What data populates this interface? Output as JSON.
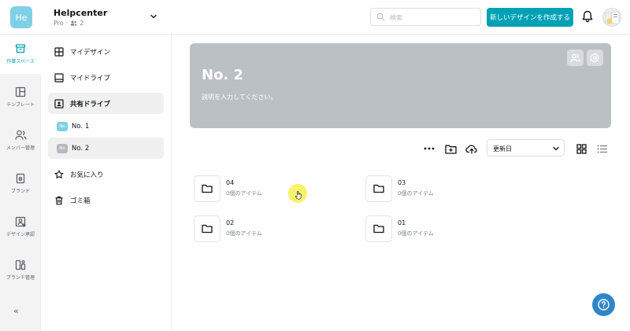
{
  "header": {
    "team_avatar": "He",
    "team_name": "Helpcenter",
    "team_plan": "Pro",
    "member_count": "2",
    "search_placeholder": "検索",
    "create_button": "新しいデザインを作成する"
  },
  "rail": {
    "items": [
      {
        "label": "作業スペース",
        "icon": "archive-icon",
        "active": true
      },
      {
        "label": "テンプレート",
        "icon": "template-icon",
        "active": false
      },
      {
        "label": "メンバー管理",
        "icon": "members-icon",
        "active": false
      },
      {
        "label": "ブランド",
        "icon": "brand-icon",
        "active": false
      },
      {
        "label": "デザイン承認",
        "icon": "approval-icon",
        "active": false
      },
      {
        "label": "ブランド管理",
        "icon": "brand-manage-icon",
        "active": false
      }
    ],
    "collapse": "«"
  },
  "nav": {
    "items": [
      {
        "label": "マイデザイン",
        "icon": "grid-icon"
      },
      {
        "label": "マイドライブ",
        "icon": "drive-icon"
      },
      {
        "label": "共有ドライブ",
        "icon": "shared-drive-icon",
        "selected": true
      },
      {
        "label": "No. 1",
        "badge": "No",
        "badge_color": "#7fd0e6"
      },
      {
        "label": "No. 2",
        "badge": "No",
        "badge_color": "#b4b9bf",
        "selected": true
      },
      {
        "label": "お気に入り",
        "icon": "star-icon"
      },
      {
        "label": "ゴミ箱",
        "icon": "trash-icon"
      }
    ]
  },
  "banner": {
    "title": "No. 2",
    "description": "説明を入力してください。"
  },
  "toolbar": {
    "sort_label": "更新日"
  },
  "folders": [
    {
      "name": "04",
      "count": "0個のアイテム"
    },
    {
      "name": "03",
      "count": "0個のアイテム"
    },
    {
      "name": "02",
      "count": "0個のアイテム"
    },
    {
      "name": "01",
      "count": "0個のアイテム"
    }
  ],
  "colors": {
    "accent": "#00a1b4",
    "banner": "#bbc0c5",
    "help_button": "#2e86c9"
  }
}
